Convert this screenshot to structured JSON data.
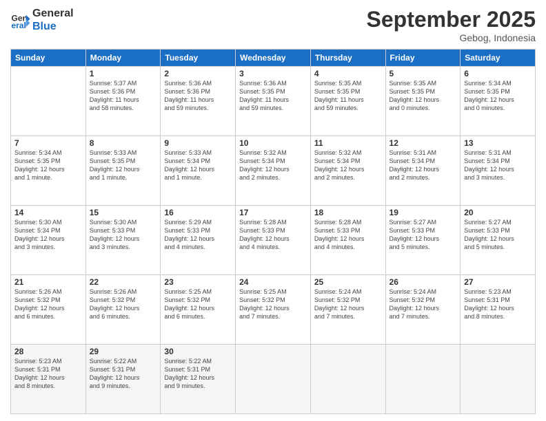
{
  "header": {
    "logo_line1": "General",
    "logo_line2": "Blue",
    "month": "September 2025",
    "location": "Gebog, Indonesia"
  },
  "days_of_week": [
    "Sunday",
    "Monday",
    "Tuesday",
    "Wednesday",
    "Thursday",
    "Friday",
    "Saturday"
  ],
  "weeks": [
    [
      {
        "day": "",
        "info": ""
      },
      {
        "day": "1",
        "info": "Sunrise: 5:37 AM\nSunset: 5:36 PM\nDaylight: 11 hours\nand 58 minutes."
      },
      {
        "day": "2",
        "info": "Sunrise: 5:36 AM\nSunset: 5:36 PM\nDaylight: 11 hours\nand 59 minutes."
      },
      {
        "day": "3",
        "info": "Sunrise: 5:36 AM\nSunset: 5:35 PM\nDaylight: 11 hours\nand 59 minutes."
      },
      {
        "day": "4",
        "info": "Sunrise: 5:35 AM\nSunset: 5:35 PM\nDaylight: 11 hours\nand 59 minutes."
      },
      {
        "day": "5",
        "info": "Sunrise: 5:35 AM\nSunset: 5:35 PM\nDaylight: 12 hours\nand 0 minutes."
      },
      {
        "day": "6",
        "info": "Sunrise: 5:34 AM\nSunset: 5:35 PM\nDaylight: 12 hours\nand 0 minutes."
      }
    ],
    [
      {
        "day": "7",
        "info": "Sunrise: 5:34 AM\nSunset: 5:35 PM\nDaylight: 12 hours\nand 1 minute."
      },
      {
        "day": "8",
        "info": "Sunrise: 5:33 AM\nSunset: 5:35 PM\nDaylight: 12 hours\nand 1 minute."
      },
      {
        "day": "9",
        "info": "Sunrise: 5:33 AM\nSunset: 5:34 PM\nDaylight: 12 hours\nand 1 minute."
      },
      {
        "day": "10",
        "info": "Sunrise: 5:32 AM\nSunset: 5:34 PM\nDaylight: 12 hours\nand 2 minutes."
      },
      {
        "day": "11",
        "info": "Sunrise: 5:32 AM\nSunset: 5:34 PM\nDaylight: 12 hours\nand 2 minutes."
      },
      {
        "day": "12",
        "info": "Sunrise: 5:31 AM\nSunset: 5:34 PM\nDaylight: 12 hours\nand 2 minutes."
      },
      {
        "day": "13",
        "info": "Sunrise: 5:31 AM\nSunset: 5:34 PM\nDaylight: 12 hours\nand 3 minutes."
      }
    ],
    [
      {
        "day": "14",
        "info": "Sunrise: 5:30 AM\nSunset: 5:34 PM\nDaylight: 12 hours\nand 3 minutes."
      },
      {
        "day": "15",
        "info": "Sunrise: 5:30 AM\nSunset: 5:33 PM\nDaylight: 12 hours\nand 3 minutes."
      },
      {
        "day": "16",
        "info": "Sunrise: 5:29 AM\nSunset: 5:33 PM\nDaylight: 12 hours\nand 4 minutes."
      },
      {
        "day": "17",
        "info": "Sunrise: 5:28 AM\nSunset: 5:33 PM\nDaylight: 12 hours\nand 4 minutes."
      },
      {
        "day": "18",
        "info": "Sunrise: 5:28 AM\nSunset: 5:33 PM\nDaylight: 12 hours\nand 4 minutes."
      },
      {
        "day": "19",
        "info": "Sunrise: 5:27 AM\nSunset: 5:33 PM\nDaylight: 12 hours\nand 5 minutes."
      },
      {
        "day": "20",
        "info": "Sunrise: 5:27 AM\nSunset: 5:33 PM\nDaylight: 12 hours\nand 5 minutes."
      }
    ],
    [
      {
        "day": "21",
        "info": "Sunrise: 5:26 AM\nSunset: 5:32 PM\nDaylight: 12 hours\nand 6 minutes."
      },
      {
        "day": "22",
        "info": "Sunrise: 5:26 AM\nSunset: 5:32 PM\nDaylight: 12 hours\nand 6 minutes."
      },
      {
        "day": "23",
        "info": "Sunrise: 5:25 AM\nSunset: 5:32 PM\nDaylight: 12 hours\nand 6 minutes."
      },
      {
        "day": "24",
        "info": "Sunrise: 5:25 AM\nSunset: 5:32 PM\nDaylight: 12 hours\nand 7 minutes."
      },
      {
        "day": "25",
        "info": "Sunrise: 5:24 AM\nSunset: 5:32 PM\nDaylight: 12 hours\nand 7 minutes."
      },
      {
        "day": "26",
        "info": "Sunrise: 5:24 AM\nSunset: 5:32 PM\nDaylight: 12 hours\nand 7 minutes."
      },
      {
        "day": "27",
        "info": "Sunrise: 5:23 AM\nSunset: 5:31 PM\nDaylight: 12 hours\nand 8 minutes."
      }
    ],
    [
      {
        "day": "28",
        "info": "Sunrise: 5:23 AM\nSunset: 5:31 PM\nDaylight: 12 hours\nand 8 minutes."
      },
      {
        "day": "29",
        "info": "Sunrise: 5:22 AM\nSunset: 5:31 PM\nDaylight: 12 hours\nand 9 minutes."
      },
      {
        "day": "30",
        "info": "Sunrise: 5:22 AM\nSunset: 5:31 PM\nDaylight: 12 hours\nand 9 minutes."
      },
      {
        "day": "",
        "info": ""
      },
      {
        "day": "",
        "info": ""
      },
      {
        "day": "",
        "info": ""
      },
      {
        "day": "",
        "info": ""
      }
    ]
  ]
}
